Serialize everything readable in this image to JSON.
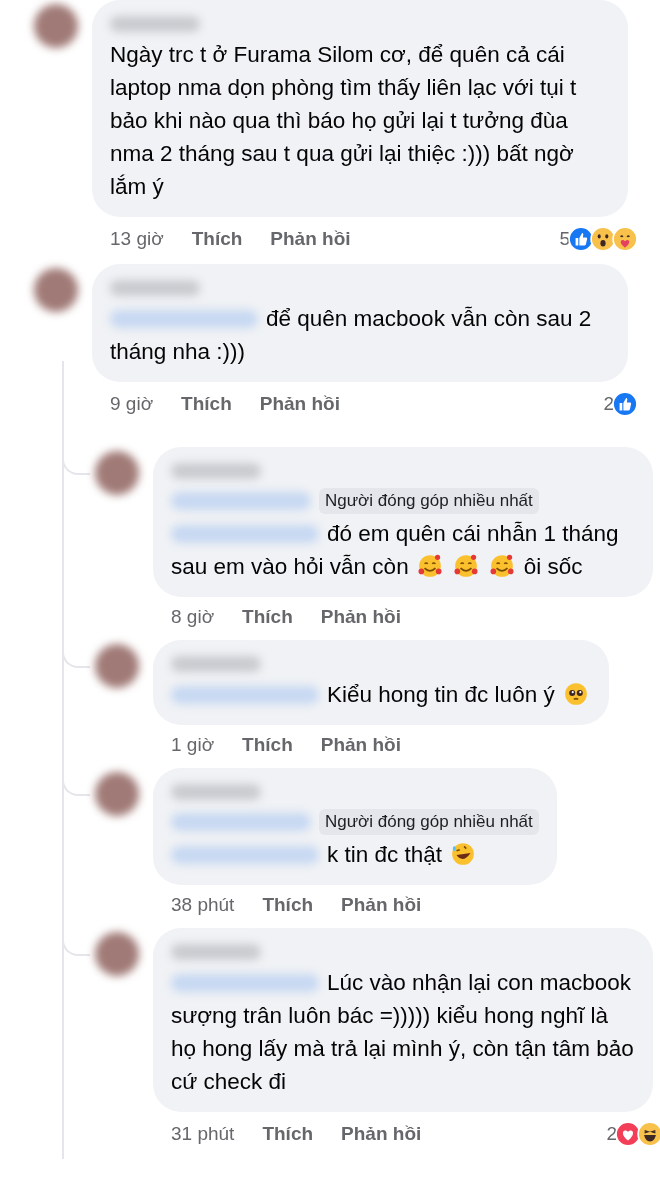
{
  "comments": [
    {
      "body": [
        {
          "kind": "text",
          "text": "Ngày trc t ở Furama Silom cơ, để quên cả cái laptop nma dọn phòng tìm thấy liên lạc với tụi t bảo khi nào qua thì báo họ gửi lại t tưởng đùa nma 2 tháng sau t qua gửi lại thiệc :))) bất ngờ lắm ý"
        }
      ],
      "time": "13 giờ",
      "like": "Thích",
      "reply": "Phản hồi",
      "reaction_count": "5",
      "reactions": [
        {
          "kind": "like"
        },
        {
          "kind": "wow"
        },
        {
          "kind": "care"
        }
      ]
    },
    {
      "mention": true,
      "body": [
        {
          "kind": "text",
          "text": "để quên macbook vẫn còn sau 2 tháng nha :)))"
        }
      ],
      "time": "9 giờ",
      "like": "Thích",
      "reply": "Phản hồi",
      "reaction_count": "2",
      "reactions": [
        {
          "kind": "like"
        }
      ],
      "children": [
        {
          "mention": true,
          "badge": "Người đóng góp nhiều nhất",
          "body": [
            {
              "kind": "text",
              "text": "đó em quên cái nhẫn 1 tháng"
            },
            {
              "kind": "text",
              "text": "sau em vào hỏi vẫn còn"
            },
            {
              "kind": "hearts-face"
            },
            {
              "kind": "hearts-face"
            },
            {
              "kind": "hearts-face"
            },
            {
              "kind": "text",
              "text": "ôi sốc"
            }
          ],
          "time": "8 giờ",
          "like": "Thích",
          "reply": "Phản hồi"
        },
        {
          "mention": true,
          "body": [
            {
              "kind": "text",
              "text": "Kiểu hong tin đc luôn ý"
            },
            {
              "kind": "pleading-face"
            }
          ],
          "time": "1 giờ",
          "like": "Thích",
          "reply": "Phản hồi"
        },
        {
          "mention": true,
          "badge": "Người đóng góp nhiều nhất",
          "body": [
            {
              "kind": "text",
              "text": "k tin đc thật"
            },
            {
              "kind": "rofl-face"
            }
          ],
          "time": "38 phút",
          "like": "Thích",
          "reply": "Phản hồi"
        },
        {
          "mention": true,
          "body": [
            {
              "kind": "text",
              "text": "Lúc vào nhận lại con macbook sượng trân luôn bác =))))) kiểu hong nghĩ là họ hong lấy mà trả lại mình ý, còn tận tâm bảo cứ check đi"
            }
          ],
          "time": "31 phút",
          "like": "Thích",
          "reply": "Phản hồi",
          "reaction_count": "2",
          "reactions": [
            {
              "kind": "love"
            },
            {
              "kind": "haha"
            }
          ]
        }
      ]
    }
  ]
}
